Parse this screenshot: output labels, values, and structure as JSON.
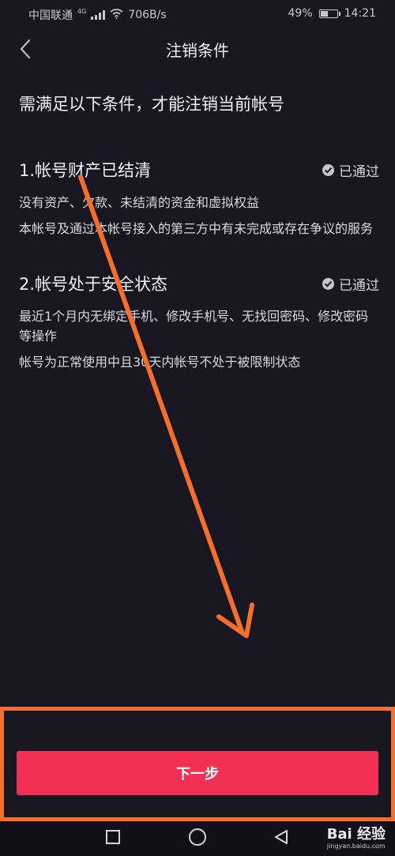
{
  "status_bar": {
    "carrier": "中国联通",
    "network": "4G",
    "speed": "706B/s",
    "battery_percent": "49%",
    "battery_level": 0.49,
    "time": "14:21",
    "icons": [
      "signal-icon",
      "wifi-icon",
      "battery-icon"
    ]
  },
  "header": {
    "back_icon": "chevron-left-icon",
    "title": "注销条件"
  },
  "main": {
    "intro": "需满足以下条件，才能注销当前帐号",
    "conditions": [
      {
        "title": "1.帐号财产已结清",
        "status": "已通过",
        "details": [
          "没有资产、欠款、未结清的资金和虚拟权益",
          "本帐号及通过本帐号接入的第三方中有未完成或存在争议的服务"
        ]
      },
      {
        "title": "2.帐号处于安全状态",
        "status": "已通过",
        "details": [
          "最近1个月内无绑定手机、修改手机号、无找回密码、修改密码等操作",
          "帐号为正常使用中且30天内帐号不处于被限制状态"
        ]
      }
    ]
  },
  "footer": {
    "next_button": "下一步"
  },
  "nav_bar": {
    "icons": [
      "square-icon",
      "circle-icon",
      "triangle-back-icon"
    ],
    "watermark": {
      "main": "Bai  经验",
      "sub": "jingyan.baidu.com"
    }
  },
  "colors": {
    "background": "#171621",
    "accent": "#f22f55",
    "annotation": "#f46f2c"
  }
}
